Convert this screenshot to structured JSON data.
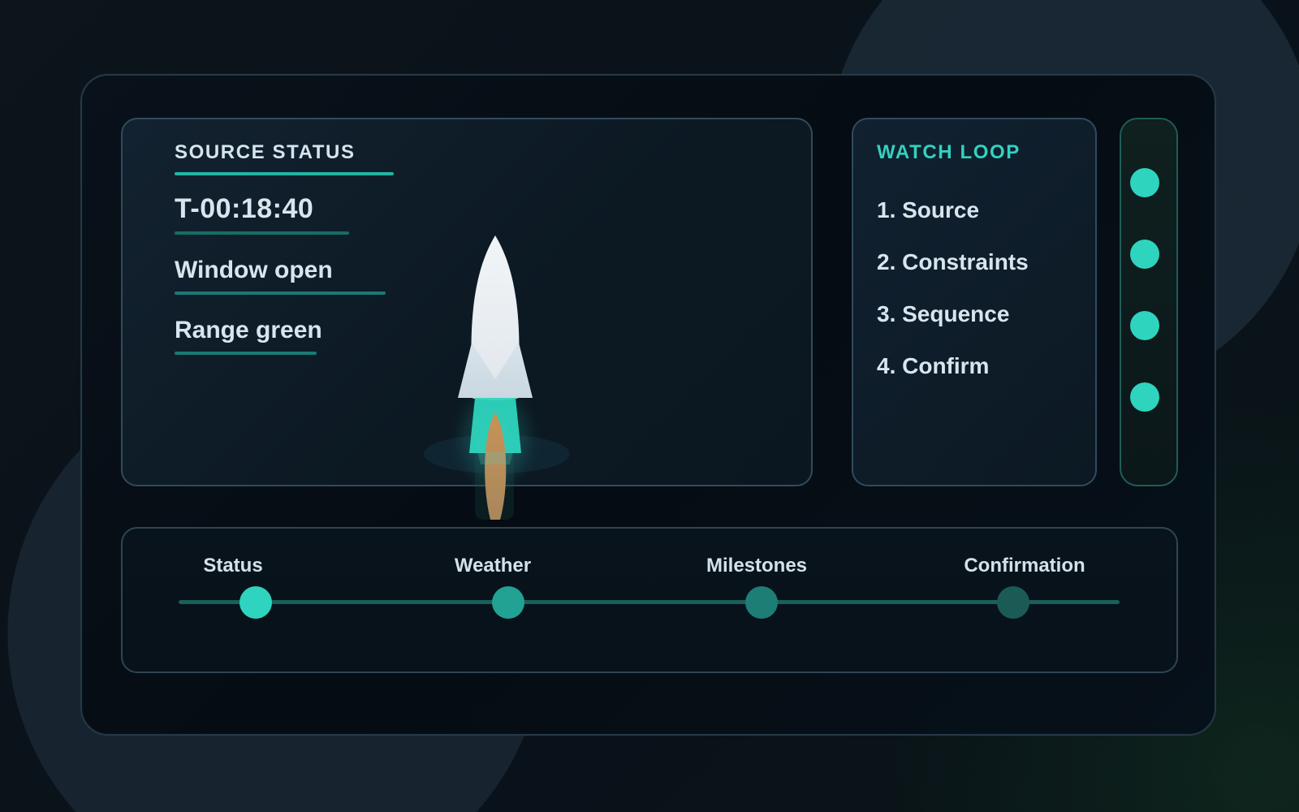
{
  "source_status": {
    "title": "SOURCE STATUS",
    "lines": [
      "T-00:18:40",
      "Window open",
      "Range green"
    ]
  },
  "watch_loop": {
    "title": "WATCH LOOP",
    "items": [
      "1. Source",
      "2. Constraints",
      "3. Sequence",
      "4. Confirm"
    ]
  },
  "timeline": {
    "steps": [
      "Status",
      "Weather",
      "Milestones",
      "Confirmation"
    ]
  },
  "icons": {
    "rocket": "rocket-icon",
    "indicator": "status-dot-icon",
    "timeline_node": "timeline-node-icon"
  },
  "colors": {
    "accent": "#2ed4be",
    "accent_dark": "#1b7a73",
    "text": "#d7e6ee",
    "flame_orange": "#b08a60"
  }
}
